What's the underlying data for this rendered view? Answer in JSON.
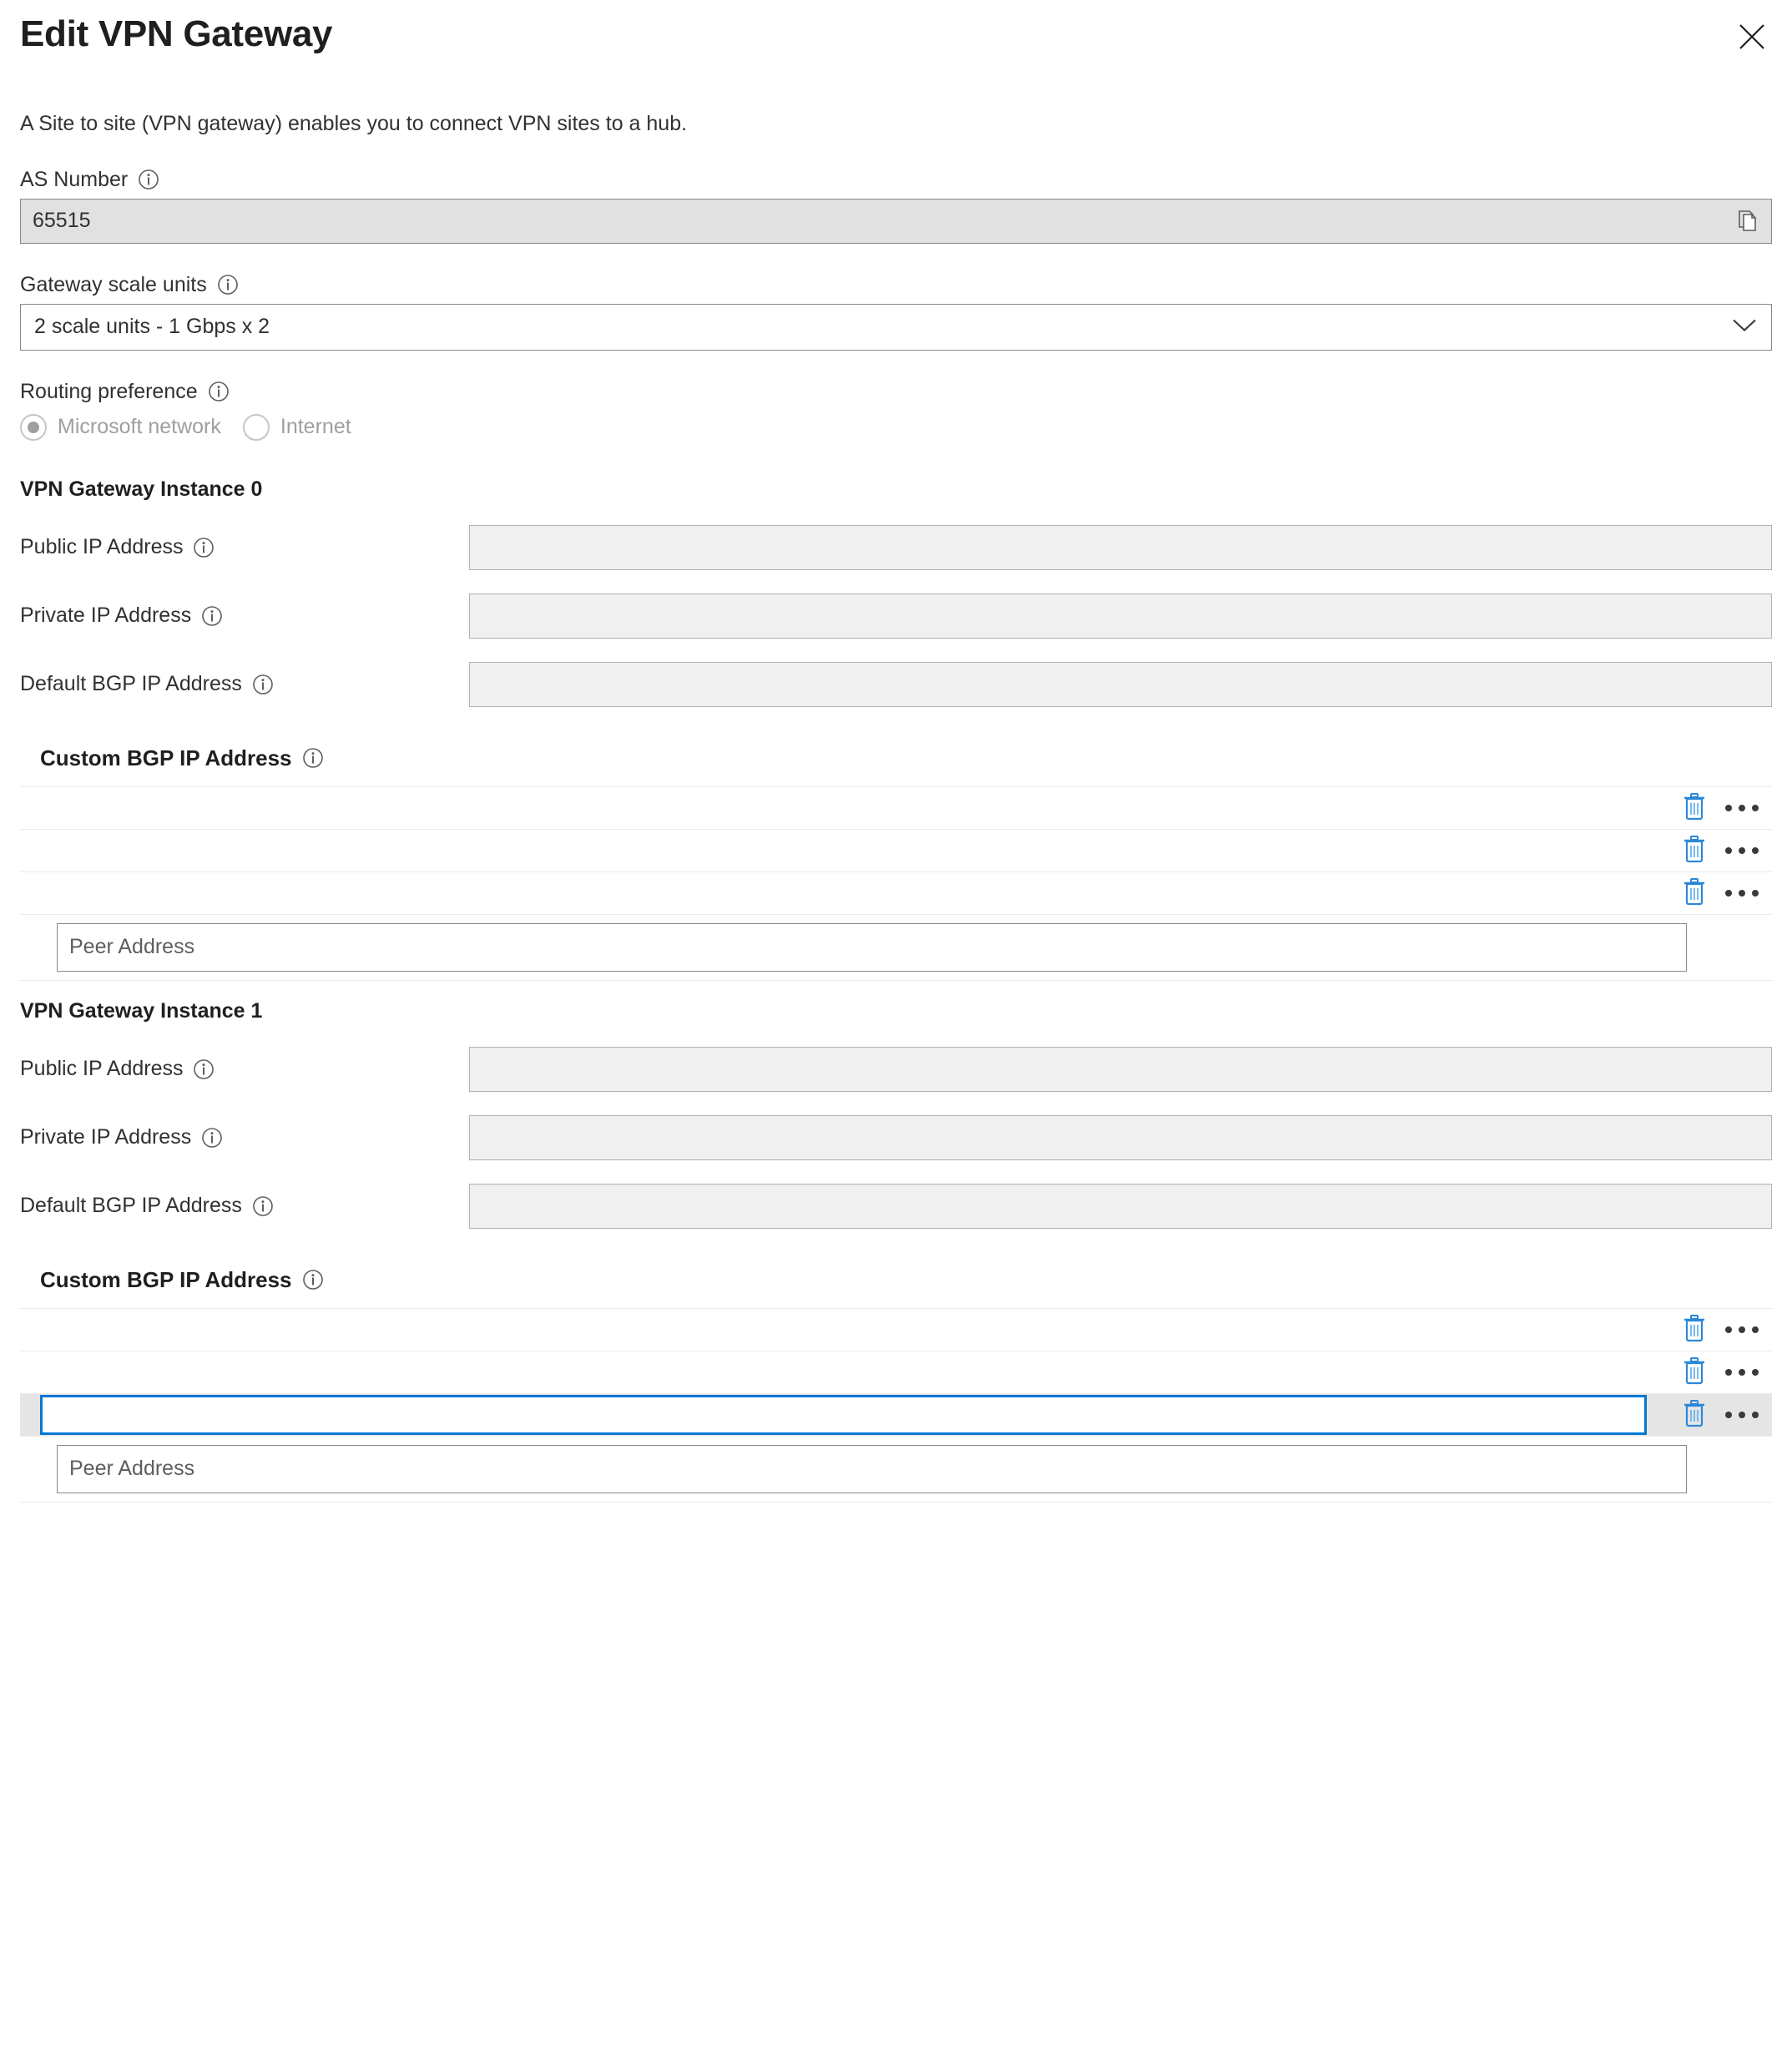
{
  "header": {
    "title": "Edit VPN Gateway",
    "close_icon": "close-icon"
  },
  "description": "A Site to site (VPN gateway) enables you to connect VPN sites to a hub.",
  "as_number": {
    "label": "AS Number",
    "value": "65515",
    "copy_icon": "copy-icon",
    "info_icon": "info-icon"
  },
  "gateway_scale_units": {
    "label": "Gateway scale units",
    "selected": "2 scale units - 1 Gbps x 2",
    "chevron_icon": "chevron-down-icon",
    "info_icon": "info-icon"
  },
  "routing_preference": {
    "label": "Routing preference",
    "info_icon": "info-icon",
    "options": [
      {
        "label": "Microsoft network",
        "selected": true
      },
      {
        "label": "Internet",
        "selected": false
      }
    ]
  },
  "instances": [
    {
      "heading": "VPN Gateway Instance 0",
      "fields": [
        {
          "label": "Public IP Address",
          "value": ""
        },
        {
          "label": "Private IP Address",
          "value": ""
        },
        {
          "label": "Default BGP IP Address",
          "value": ""
        }
      ],
      "custom_bgp": {
        "heading": "Custom BGP IP Address",
        "rows": [
          {
            "value": "",
            "focused": false,
            "selected": false,
            "delete_icon": "trash-icon",
            "more_icon": "ellipsis-icon"
          },
          {
            "value": "",
            "focused": false,
            "selected": false,
            "delete_icon": "trash-icon",
            "more_icon": "ellipsis-icon"
          },
          {
            "value": "",
            "focused": false,
            "selected": false,
            "delete_icon": "trash-icon",
            "more_icon": "ellipsis-icon"
          }
        ],
        "peer_placeholder": "Peer Address",
        "peer_value": ""
      }
    },
    {
      "heading": "VPN Gateway Instance 1",
      "fields": [
        {
          "label": "Public IP Address",
          "value": ""
        },
        {
          "label": "Private IP Address",
          "value": ""
        },
        {
          "label": "Default BGP IP Address",
          "value": ""
        }
      ],
      "custom_bgp": {
        "heading": "Custom BGP IP Address",
        "rows": [
          {
            "value": "",
            "focused": false,
            "selected": false,
            "delete_icon": "trash-icon",
            "more_icon": "ellipsis-icon"
          },
          {
            "value": "",
            "focused": false,
            "selected": false,
            "delete_icon": "trash-icon",
            "more_icon": "ellipsis-icon"
          },
          {
            "value": "",
            "focused": true,
            "selected": true,
            "delete_icon": "trash-icon",
            "more_icon": "ellipsis-icon"
          }
        ],
        "peer_placeholder": "Peer Address",
        "peer_value": ""
      }
    }
  ],
  "colors": {
    "accent_blue": "#0078d4",
    "trash_blue": "#2b88d8",
    "text": "#201f1e",
    "disabled_text": "#a19f9d",
    "readonly_bg": "#e1e1e1",
    "field_bg": "#f0f0f0",
    "row_selected_bg": "#e5e5e5",
    "divider": "#edebe9"
  }
}
